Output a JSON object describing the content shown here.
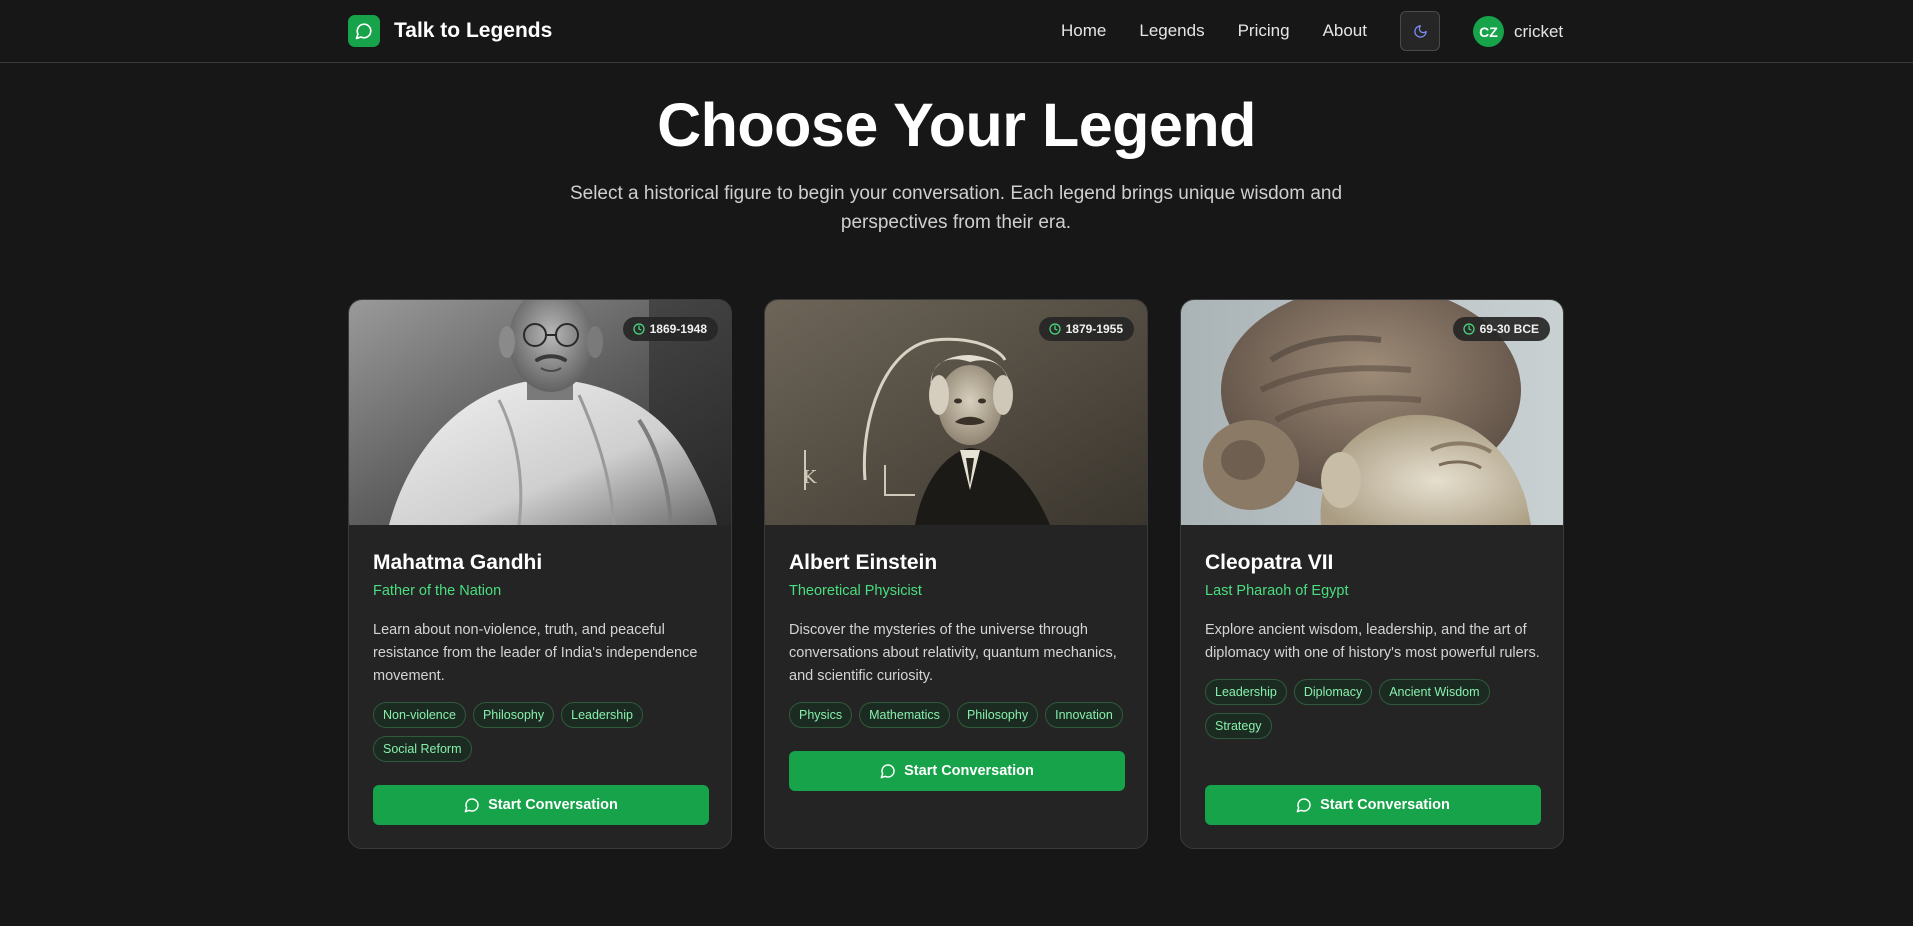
{
  "brand": {
    "name": "Talk to Legends",
    "logo_icon": "message-circle-icon"
  },
  "nav": {
    "links": [
      {
        "label": "Home"
      },
      {
        "label": "Legends"
      },
      {
        "label": "Pricing"
      },
      {
        "label": "About"
      }
    ],
    "theme_toggle_icon": "moon-icon",
    "user": {
      "initials": "CZ",
      "name": "cricket"
    }
  },
  "hero": {
    "title": "Choose Your Legend",
    "subtitle": "Select a historical figure to begin your conversation. Each legend brings unique wisdom and perspectives from their era."
  },
  "colors": {
    "accent": "#16a34a",
    "accent_text": "#4ade80",
    "background": "#171717",
    "card": "#242424"
  },
  "legends": [
    {
      "name": "Mahatma Gandhi",
      "role": "Father of the Nation",
      "era": "1869-1948",
      "description": "Learn about non-violence, truth, and peaceful resistance from the leader of India's independence movement.",
      "tags": [
        "Non-violence",
        "Philosophy",
        "Leadership",
        "Social Reform"
      ],
      "button_label": "Start Conversation",
      "portrait": "gandhi-portrait"
    },
    {
      "name": "Albert Einstein",
      "role": "Theoretical Physicist",
      "era": "1879-1955",
      "description": "Discover the mysteries of the universe through conversations about relativity, quantum mechanics, and scientific curiosity.",
      "tags": [
        "Physics",
        "Mathematics",
        "Philosophy",
        "Innovation"
      ],
      "button_label": "Start Conversation",
      "portrait": "einstein-portrait"
    },
    {
      "name": "Cleopatra VII",
      "role": "Last Pharaoh of Egypt",
      "era": "69-30 BCE",
      "description": "Explore ancient wisdom, leadership, and the art of diplomacy with one of history's most powerful rulers.",
      "tags": [
        "Leadership",
        "Diplomacy",
        "Ancient Wisdom",
        "Strategy"
      ],
      "button_label": "Start Conversation",
      "portrait": "cleopatra-bust"
    }
  ]
}
